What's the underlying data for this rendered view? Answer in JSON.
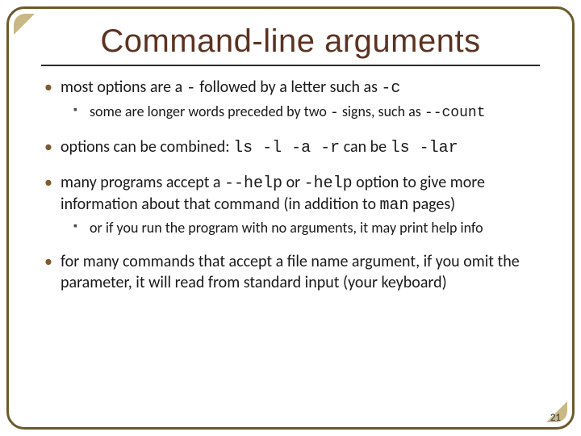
{
  "title": "Command-line arguments",
  "bullets": {
    "b1_a": "most options are a ",
    "b1_mono1": "-",
    "b1_b": " followed by a letter such as ",
    "b1_mono2": "-c",
    "b1s_a": "some are longer words preceded by two ",
    "b1s_mono1": "-",
    "b1s_b": " signs, such as ",
    "b1s_mono2": "--count",
    "b2_a": "options can be combined: ",
    "b2_mono1": "ls -l -a -r",
    "b2_b": " can be ",
    "b2_mono2": "ls -lar",
    "b3_a": "many programs accept a ",
    "b3_mono1": "--help",
    "b3_b": " or ",
    "b3_mono2": "-help",
    "b3_c": " option to give more information about that command (in addition to ",
    "b3_mono3": "man",
    "b3_d": " pages)",
    "b3s": "or if you run the program with no arguments, it may print help info",
    "b4": "for many commands that accept a file name argument, if you omit the parameter, it will read from standard input (your keyboard)"
  },
  "page_number": "21"
}
